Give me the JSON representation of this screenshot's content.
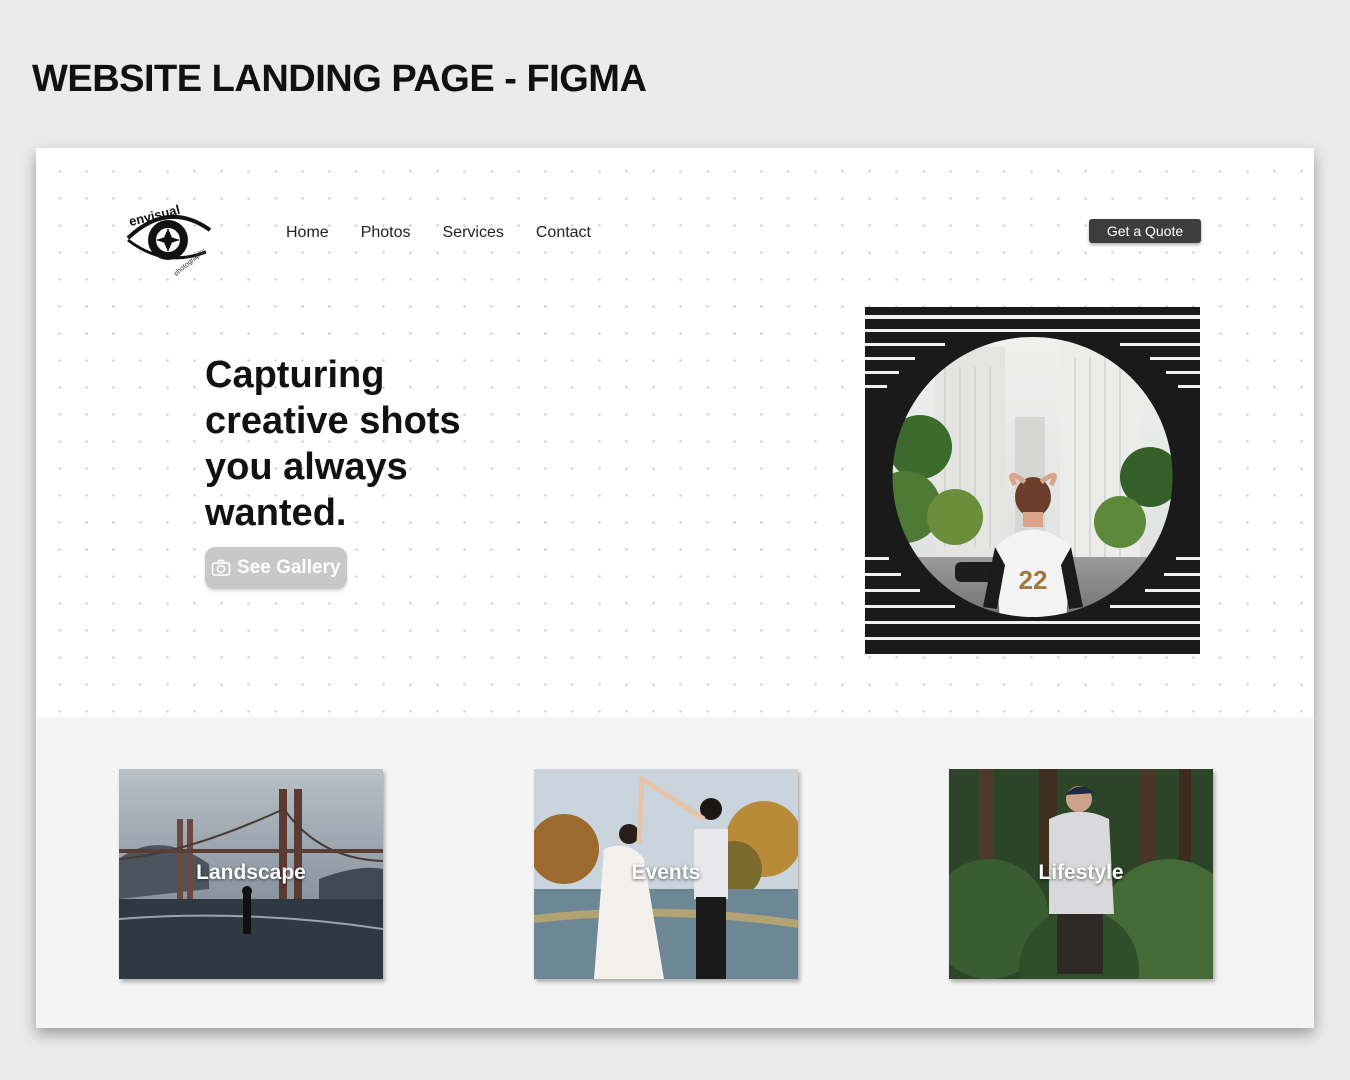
{
  "page_heading": "WEBSITE LANDING PAGE - FIGMA",
  "logo": {
    "brand": "envisual",
    "tagline": "photography"
  },
  "nav": {
    "items": [
      "Home",
      "Photos",
      "Services",
      "Contact"
    ]
  },
  "header": {
    "cta_label": "Get a Quote"
  },
  "hero": {
    "headline_lines": [
      "Capturing",
      "creative shots",
      "you always",
      "wanted."
    ],
    "gallery_button_label": "See Gallery",
    "photo_jersey_number": "22"
  },
  "categories": [
    {
      "label": "Landscape"
    },
    {
      "label": "Events"
    },
    {
      "label": "Lifestyle"
    }
  ],
  "colors": {
    "page_bg": "#ebebeb",
    "frame_bg": "#ffffff",
    "bottom_bg": "#f4f4f4",
    "cta_bg": "#3d3d3d",
    "gallery_button_bg": "#c8c8c8"
  }
}
